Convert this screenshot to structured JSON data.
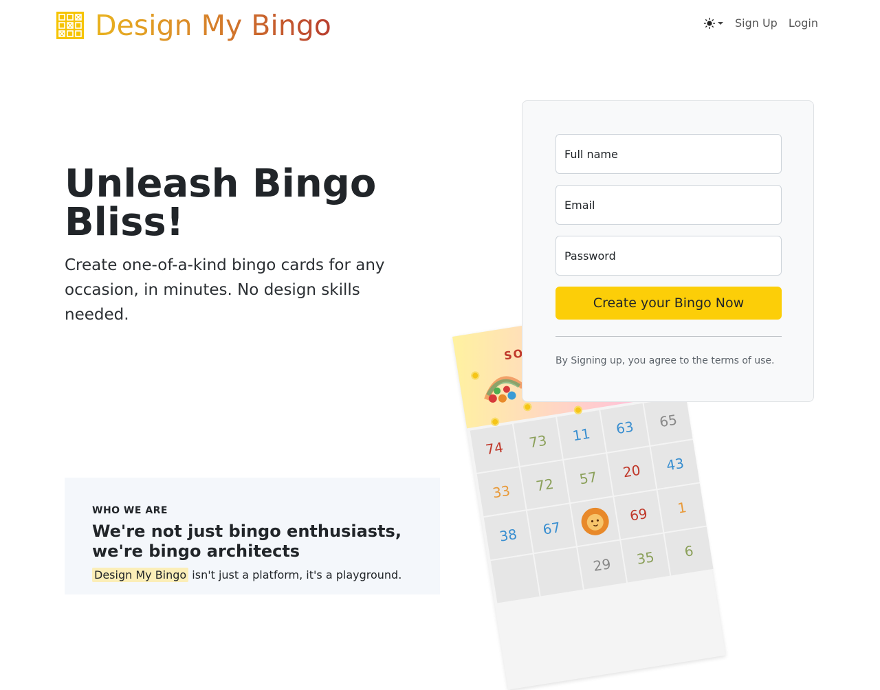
{
  "header": {
    "brand_name": "Design My Bingo",
    "theme_icon": "sun-icon",
    "nav": {
      "signup": "Sign Up",
      "login": "Login"
    }
  },
  "hero": {
    "title": "Unleash Bingo Bliss!",
    "subtitle": "Create one-of-a-kind bingo cards for any occasion, in minutes. No design skills needed."
  },
  "signup_form": {
    "full_name_placeholder": "Full name",
    "email_placeholder": "Email",
    "password_placeholder": "Password",
    "submit_label": "Create your Bingo Now",
    "terms": "By Signing up, you agree to the terms of use.",
    "accent_color": "#fcce08"
  },
  "card_preview": {
    "banner_text": "SOL",
    "center_icon": "lion-icon",
    "rows": [
      [
        "74",
        "73",
        "11",
        "63",
        "65"
      ],
      [
        "33",
        "72",
        "57",
        "20",
        "43"
      ],
      [
        "38",
        "67",
        "",
        "69",
        "1"
      ],
      [
        "",
        "",
        "29",
        "35",
        "6"
      ]
    ]
  },
  "who_we_are": {
    "eyebrow": "WHO WE ARE",
    "title": "We're not just bingo enthusiasts, we're bingo architects",
    "highlight": "Design My Bingo",
    "text_rest": " isn't just a platform, it's a playground."
  }
}
